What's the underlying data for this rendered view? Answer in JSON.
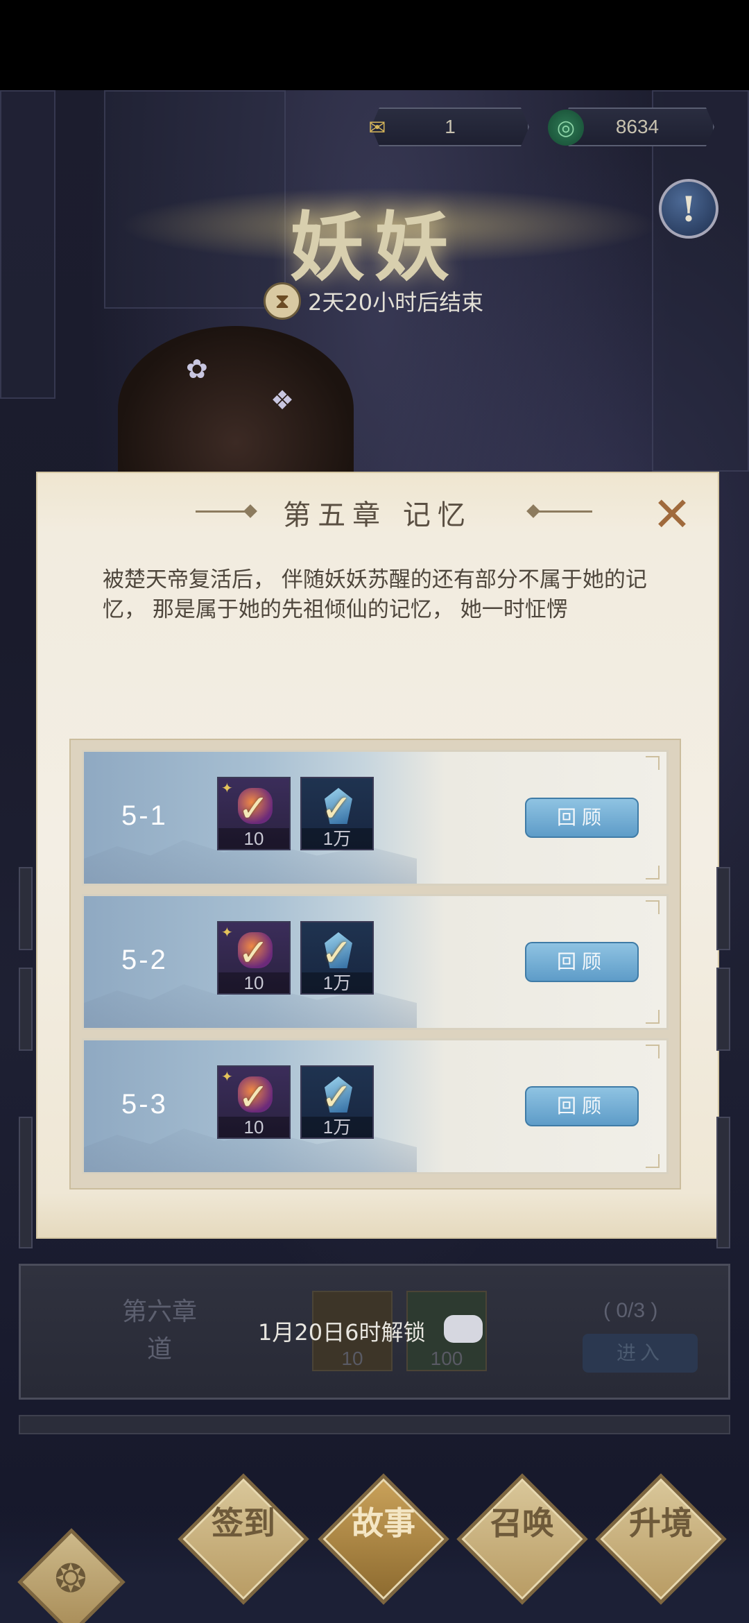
{
  "currencies": [
    {
      "icon": "scroll-ticket-icon",
      "value": "1"
    },
    {
      "icon": "jade-coin-icon",
      "value": "8634"
    }
  ],
  "event": {
    "title": "妖妖",
    "timer": "2天20小时后结束",
    "info_label": "!"
  },
  "modal": {
    "title": "第五章  记忆",
    "close_label": "✕",
    "description": "被楚天帝复活后， 伴随妖妖苏醒的还有部分不属于她的记忆， 那是属于她的先祖倾仙的记忆， 她一时怔愣",
    "stages": [
      {
        "label": "5-1",
        "rewards": [
          {
            "type": "orb",
            "qty": "10"
          },
          {
            "type": "crystal",
            "qty": "1万"
          }
        ],
        "button": "回顾"
      },
      {
        "label": "5-2",
        "rewards": [
          {
            "type": "orb",
            "qty": "10"
          },
          {
            "type": "crystal",
            "qty": "1万"
          }
        ],
        "button": "回顾"
      },
      {
        "label": "5-3",
        "rewards": [
          {
            "type": "orb",
            "qty": "10"
          },
          {
            "type": "crystal",
            "qty": "1万"
          }
        ],
        "button": "回顾"
      }
    ]
  },
  "next_chapter": {
    "name_line1": "第六章",
    "name_line2": "道",
    "unlock_text": "1月20日6时解锁",
    "rewards": [
      "10",
      "100"
    ],
    "progress": "( 0/3 )",
    "enter_label": "进入"
  },
  "nav": {
    "items": [
      "签到",
      "故事",
      "召唤",
      "升境"
    ],
    "active": "故事"
  }
}
